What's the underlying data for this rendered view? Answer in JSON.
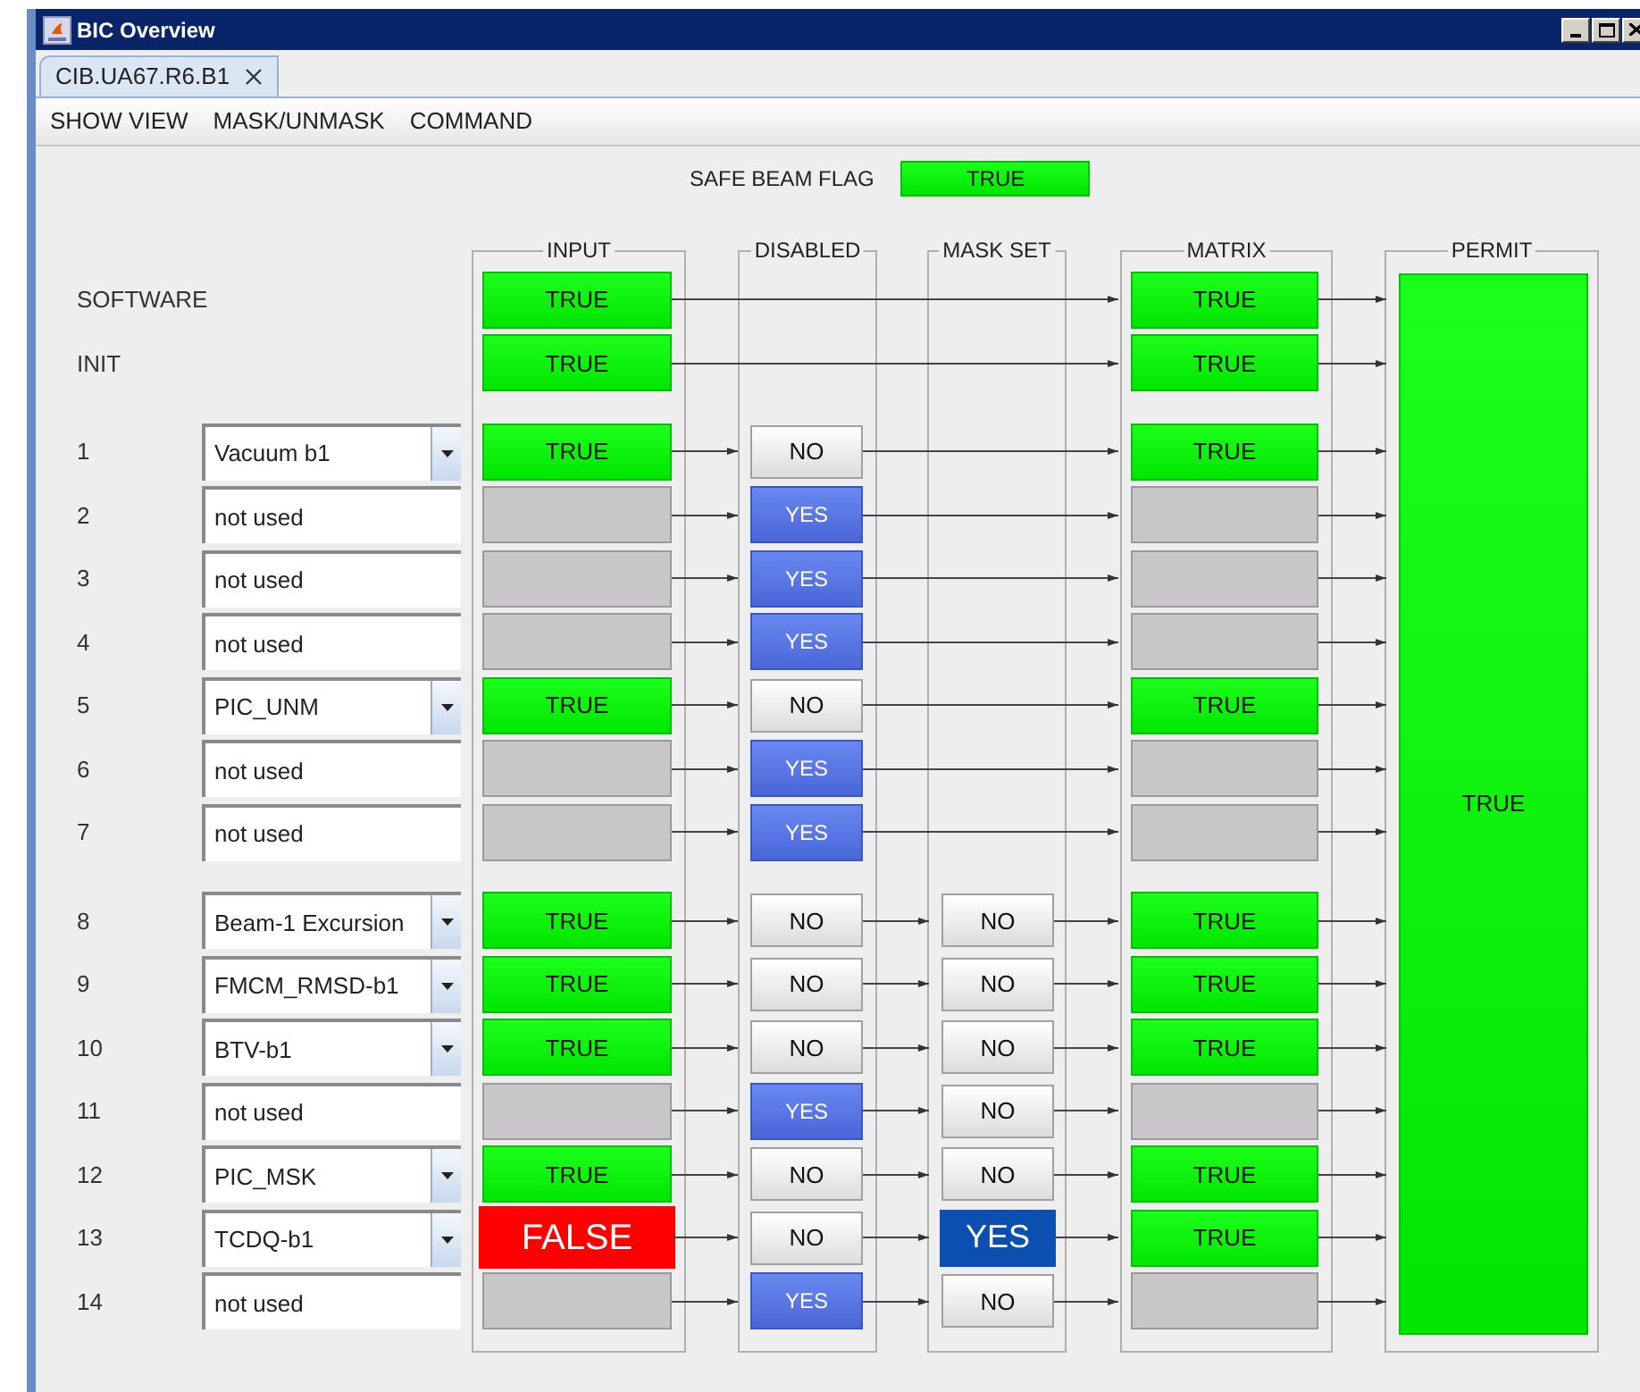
{
  "window": {
    "title": "BIC Overview"
  },
  "tabs": [
    {
      "label": "CIB.UA67.R6.B1",
      "selected": true
    }
  ],
  "menu": [
    "SHOW VIEW",
    "MASK/UNMASK",
    "COMMAND"
  ],
  "safe_beam_flag": {
    "label": "SAFE BEAM FLAG",
    "value": "TRUE",
    "kind": "ok"
  },
  "columns": [
    "INPUT",
    "DISABLED",
    "MASK SET",
    "MATRIX",
    "PERMIT"
  ],
  "sections": [
    {
      "rows": [
        {
          "kind": "system",
          "label": "SOFTWARE",
          "input": {
            "kind": "ok",
            "text": "TRUE"
          },
          "matrix": {
            "kind": "ok",
            "text": "TRUE"
          }
        },
        {
          "kind": "system",
          "label": "INIT",
          "input": {
            "kind": "ok",
            "text": "TRUE"
          },
          "matrix": {
            "kind": "ok",
            "text": "TRUE"
          }
        }
      ]
    },
    {
      "rows": [
        {
          "kind": "channel",
          "number": "1",
          "name": {
            "value": "Vacuum b1",
            "dropdown": true
          },
          "input": {
            "kind": "ok",
            "text": "TRUE"
          },
          "disabled": {
            "text": "NO",
            "on": false
          },
          "matrix": {
            "kind": "ok",
            "text": "TRUE"
          }
        },
        {
          "kind": "channel",
          "number": "2",
          "name": {
            "value": "not used",
            "dropdown": false
          },
          "input": {
            "kind": "unused"
          },
          "disabled": {
            "text": "YES",
            "on": true
          },
          "matrix": {
            "kind": "unused"
          }
        },
        {
          "kind": "channel",
          "number": "3",
          "name": {
            "value": "not used",
            "dropdown": false
          },
          "input": {
            "kind": "unused"
          },
          "disabled": {
            "text": "YES",
            "on": true
          },
          "matrix": {
            "kind": "unused"
          }
        },
        {
          "kind": "channel",
          "number": "4",
          "name": {
            "value": "not used",
            "dropdown": false
          },
          "input": {
            "kind": "unused"
          },
          "disabled": {
            "text": "YES",
            "on": true
          },
          "matrix": {
            "kind": "unused"
          }
        },
        {
          "kind": "channel",
          "number": "5",
          "name": {
            "value": "PIC_UNM",
            "dropdown": true
          },
          "input": {
            "kind": "ok",
            "text": "TRUE"
          },
          "disabled": {
            "text": "NO",
            "on": false
          },
          "matrix": {
            "kind": "ok",
            "text": "TRUE"
          }
        },
        {
          "kind": "channel",
          "number": "6",
          "name": {
            "value": "not used",
            "dropdown": false
          },
          "input": {
            "kind": "unused"
          },
          "disabled": {
            "text": "YES",
            "on": true
          },
          "matrix": {
            "kind": "unused"
          }
        },
        {
          "kind": "channel",
          "number": "7",
          "name": {
            "value": "not used",
            "dropdown": false
          },
          "input": {
            "kind": "unused"
          },
          "disabled": {
            "text": "YES",
            "on": true
          },
          "matrix": {
            "kind": "unused"
          }
        }
      ]
    },
    {
      "rows": [
        {
          "kind": "channel",
          "number": "8",
          "name": {
            "value": "Beam-1 Excursion",
            "dropdown": true
          },
          "input": {
            "kind": "ok",
            "text": "TRUE"
          },
          "disabled": {
            "text": "NO",
            "on": false
          },
          "mask_set": {
            "text": "NO",
            "on": false
          },
          "matrix": {
            "kind": "ok",
            "text": "TRUE"
          }
        },
        {
          "kind": "channel",
          "number": "9",
          "name": {
            "value": "FMCM_RMSD-b1",
            "dropdown": true
          },
          "input": {
            "kind": "ok",
            "text": "TRUE"
          },
          "disabled": {
            "text": "NO",
            "on": false
          },
          "mask_set": {
            "text": "NO",
            "on": false
          },
          "matrix": {
            "kind": "ok",
            "text": "TRUE"
          }
        },
        {
          "kind": "channel",
          "number": "10",
          "name": {
            "value": "BTV-b1",
            "dropdown": true
          },
          "input": {
            "kind": "ok",
            "text": "TRUE"
          },
          "disabled": {
            "text": "NO",
            "on": false
          },
          "mask_set": {
            "text": "NO",
            "on": false
          },
          "matrix": {
            "kind": "ok",
            "text": "TRUE"
          }
        },
        {
          "kind": "channel",
          "number": "11",
          "name": {
            "value": "not used",
            "dropdown": false
          },
          "input": {
            "kind": "unused"
          },
          "disabled": {
            "text": "YES",
            "on": true
          },
          "mask_set": {
            "text": "NO",
            "on": false
          },
          "matrix": {
            "kind": "unused"
          }
        },
        {
          "kind": "channel",
          "number": "12",
          "name": {
            "value": "PIC_MSK",
            "dropdown": true
          },
          "input": {
            "kind": "ok",
            "text": "TRUE"
          },
          "disabled": {
            "text": "NO",
            "on": false
          },
          "mask_set": {
            "text": "NO",
            "on": false
          },
          "matrix": {
            "kind": "ok",
            "text": "TRUE"
          }
        },
        {
          "kind": "channel",
          "number": "13",
          "name": {
            "value": "TCDQ-b1",
            "dropdown": true
          },
          "input": {
            "kind": "fault",
            "text": "FALSE"
          },
          "disabled": {
            "text": "NO",
            "on": false
          },
          "mask_set": {
            "text": "YES",
            "on": true
          },
          "matrix": {
            "kind": "ok",
            "text": "TRUE"
          }
        },
        {
          "kind": "channel",
          "number": "14",
          "name": {
            "value": "not used",
            "dropdown": false
          },
          "input": {
            "kind": "unused"
          },
          "disabled": {
            "text": "YES",
            "on": true
          },
          "mask_set": {
            "text": "NO",
            "on": false
          },
          "matrix": {
            "kind": "unused"
          }
        }
      ]
    }
  ],
  "permit": {
    "kind": "ok",
    "text": "TRUE"
  }
}
